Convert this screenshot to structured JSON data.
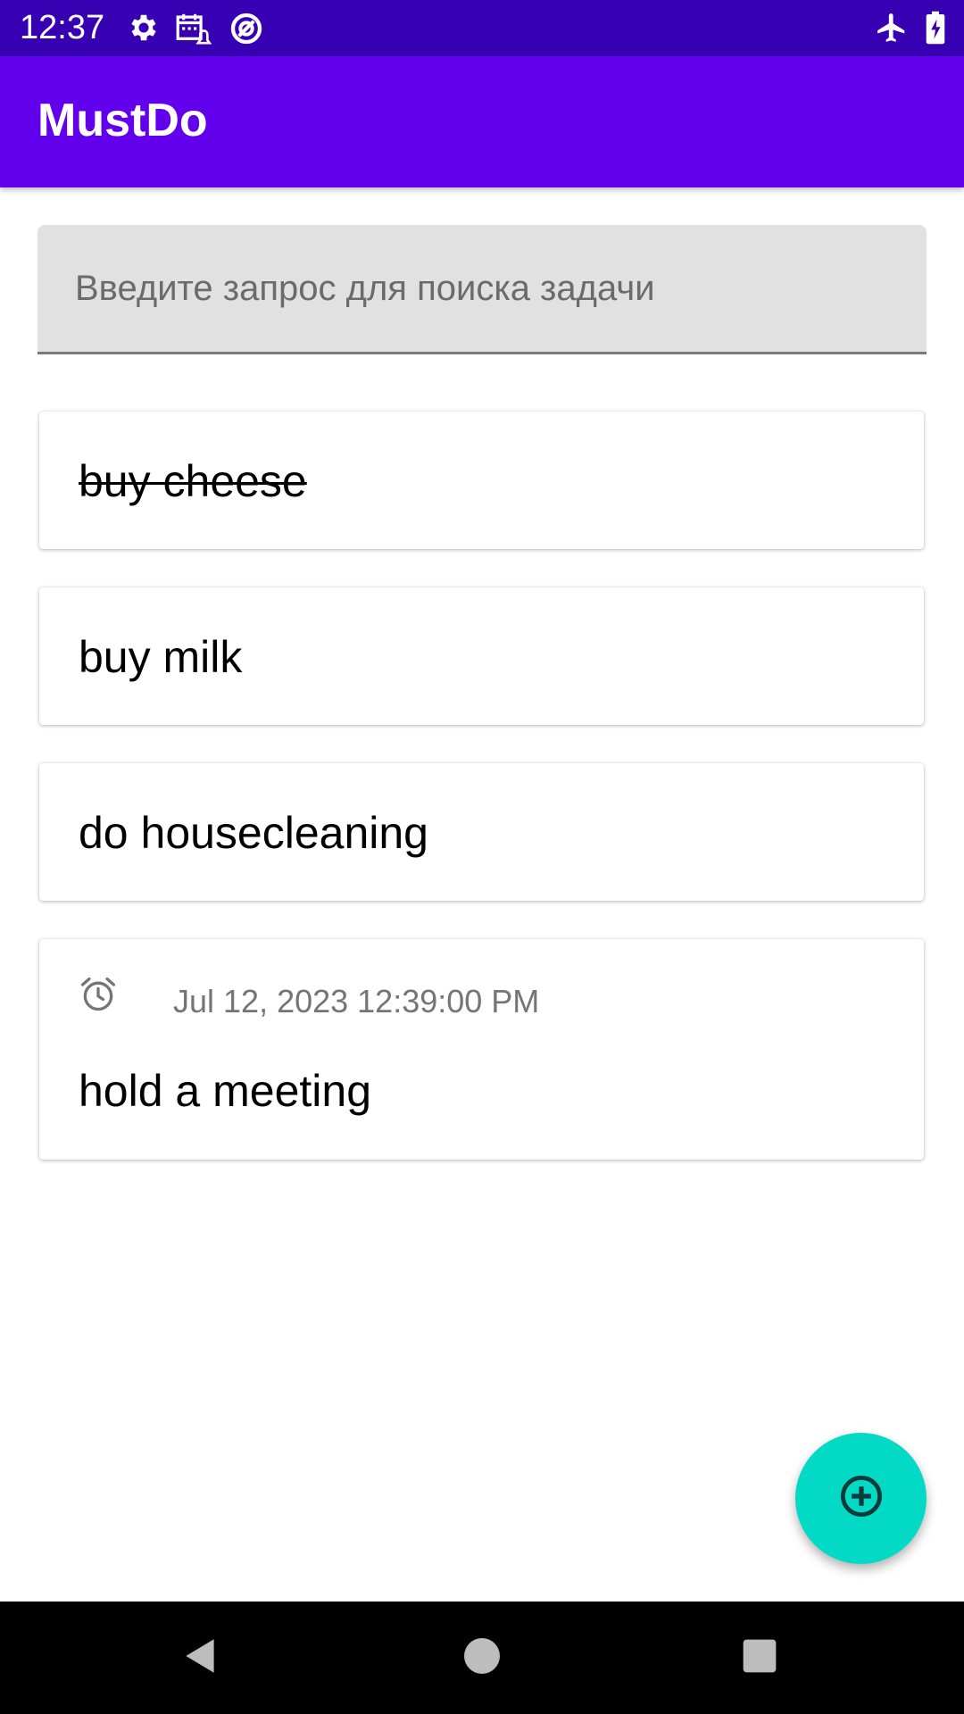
{
  "status_bar": {
    "time": "12:37",
    "left_icons": [
      "settings-gear-icon",
      "calendar-alarm-icon",
      "data-saver-icon"
    ],
    "right_icons": [
      "airplane-icon",
      "battery-charging-icon"
    ],
    "color": "#3700B3"
  },
  "app_bar": {
    "title": "MustDo",
    "color": "#6200EE"
  },
  "search": {
    "placeholder": "Введите запрос для поиска задачи",
    "value": ""
  },
  "tasks": [
    {
      "text": "buy cheese",
      "completed": true
    },
    {
      "text": "buy milk",
      "completed": false
    },
    {
      "text": "do housecleaning",
      "completed": false
    },
    {
      "text": "hold a meeting",
      "completed": false,
      "reminder": "Jul 12, 2023 12:39:00 PM",
      "reminder_icon": "alarm-clock-icon"
    }
  ],
  "fab": {
    "icon": "add-circle-icon",
    "color": "#03DAC5"
  },
  "nav_bar": {
    "icons": [
      "back-triangle-icon",
      "home-circle-icon",
      "recents-square-icon"
    ]
  }
}
